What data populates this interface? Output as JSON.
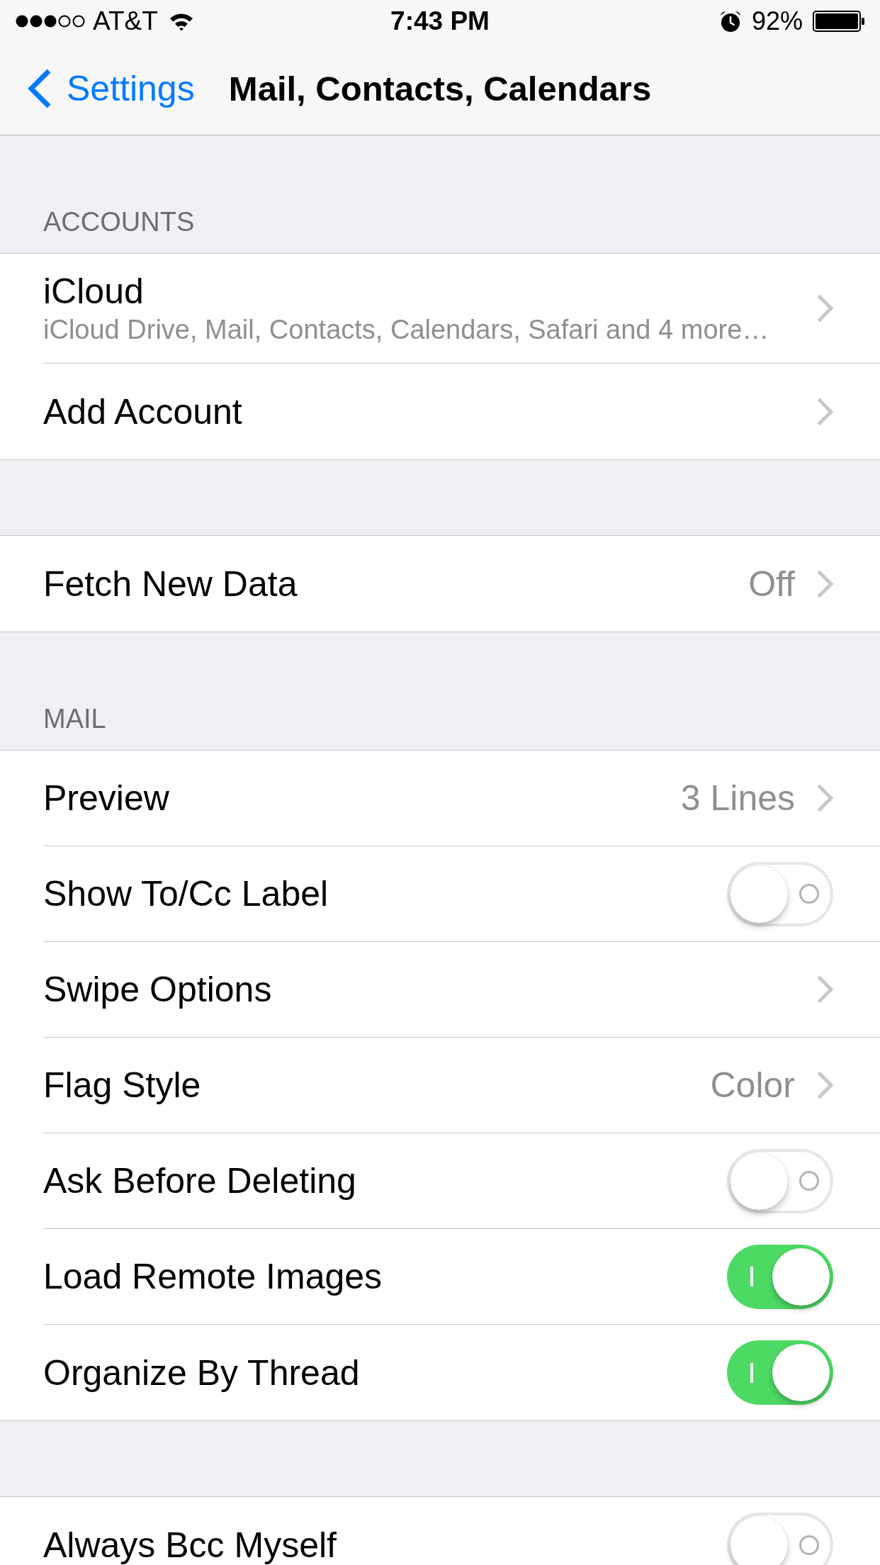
{
  "status_bar": {
    "carrier": "AT&T",
    "time": "7:43 PM",
    "battery": "92%"
  },
  "nav_bar": {
    "back": "Settings",
    "title": "Mail, Contacts, Calendars"
  },
  "sections": [
    {
      "header": "ACCOUNTS",
      "rows": [
        {
          "kind": "account",
          "label": "iCloud",
          "subtitle": "iCloud Drive, Mail, Contacts, Calendars, Safari and 4 more…"
        },
        {
          "kind": "link",
          "label": "Add Account"
        }
      ]
    },
    {
      "rows": [
        {
          "kind": "link",
          "label": "Fetch New Data",
          "value": "Off"
        }
      ]
    },
    {
      "header": "MAIL",
      "rows": [
        {
          "kind": "link",
          "label": "Preview",
          "value": "3 Lines"
        },
        {
          "kind": "toggle",
          "label": "Show To/Cc Label",
          "on": false
        },
        {
          "kind": "link",
          "label": "Swipe Options"
        },
        {
          "kind": "link",
          "label": "Flag Style",
          "value": "Color"
        },
        {
          "kind": "toggle",
          "label": "Ask Before Deleting",
          "on": false
        },
        {
          "kind": "toggle",
          "label": "Load Remote Images",
          "on": true
        },
        {
          "kind": "toggle",
          "label": "Organize By Thread",
          "on": true
        }
      ]
    },
    {
      "rows": [
        {
          "kind": "toggle",
          "label": "Always Bcc Myself",
          "on": false
        }
      ]
    }
  ]
}
